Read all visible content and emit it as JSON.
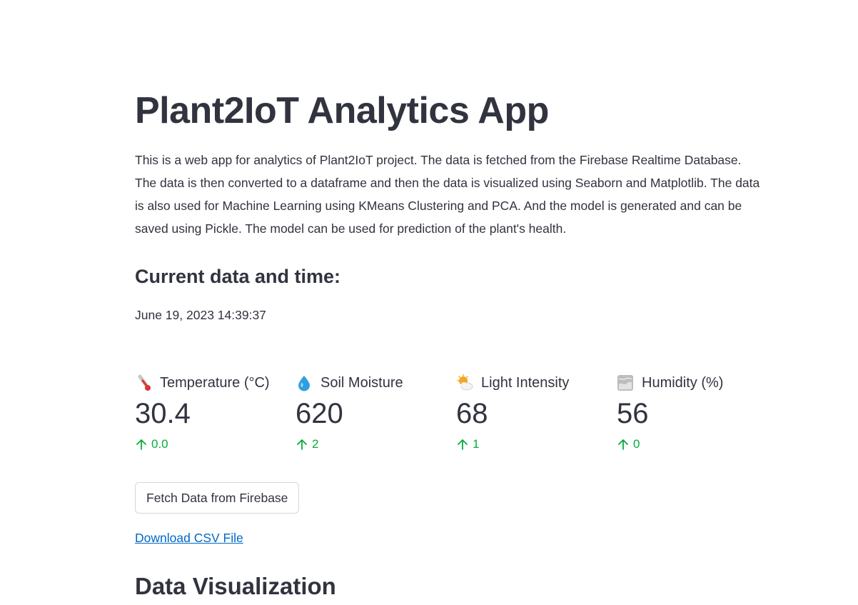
{
  "page": {
    "title": "Plant2IoT Analytics App",
    "description": "This is a web app for analytics of Plant2IoT project. The data is fetched from the Firebase Realtime Database. The data is then converted to a dataframe and then the data is visualized using Seaborn and Matplotlib. The data is also used for Machine Learning using KMeans Clustering and PCA. And the model is generated and can be saved using Pickle. The model can be used for prediction of the plant's health."
  },
  "current_time": {
    "heading": "Current data and time:",
    "value": "June 19, 2023 14:39:37"
  },
  "metrics": [
    {
      "icon": "thermometer-icon",
      "label": "Temperature (°C)",
      "value": "30.4",
      "delta": "0.0"
    },
    {
      "icon": "droplet-icon",
      "label": "Soil Moisture",
      "value": "620",
      "delta": "2"
    },
    {
      "icon": "sun-behind-cloud-icon",
      "label": "Light Intensity",
      "value": "68",
      "delta": "1"
    },
    {
      "icon": "fog-icon",
      "label": "Humidity (%)",
      "value": "56",
      "delta": "0"
    }
  ],
  "actions": {
    "fetch_button": "Fetch Data from Firebase",
    "download_link": "Download CSV File"
  },
  "sections": {
    "data_visualization": "Data Visualization"
  },
  "colors": {
    "text": "#31333f",
    "delta_positive": "#09ab3b",
    "link": "#0068c9",
    "button_border": "#d5d6da"
  }
}
